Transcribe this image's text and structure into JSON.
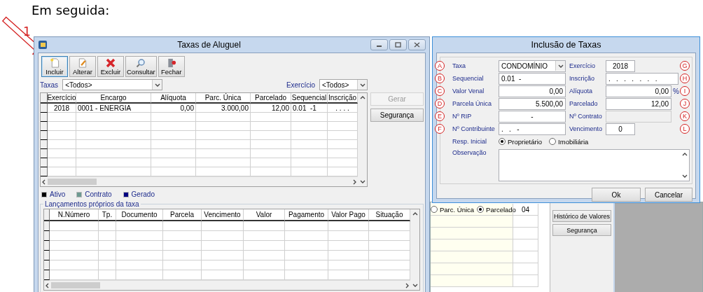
{
  "heading": "Em seguida:",
  "step_marker": "1",
  "main_window": {
    "title": "Taxas de Aluguel",
    "toolbar": [
      {
        "label": "Incluir",
        "focused": true
      },
      {
        "label": "Alterar",
        "focused": false
      },
      {
        "label": "Excluir",
        "focused": false
      },
      {
        "label": "Consultar",
        "focused": false
      },
      {
        "label": "Fechar",
        "focused": false
      }
    ],
    "filters": [
      {
        "label": "Taxas",
        "value": "<Todos>"
      },
      {
        "label": "Exercício",
        "value": "<Todos>"
      }
    ],
    "grid": {
      "columns": [
        "Exercício",
        "Encargo",
        "Alíquota",
        "Parc. Única",
        "Parcelado",
        "Sequencial",
        "Inscrição"
      ],
      "rows": [
        [
          "2018",
          "0001 - ENERGIA",
          "0,00",
          "3.000,00",
          "12,00",
          "0.01  -1",
          ". . . ."
        ]
      ]
    },
    "side_buttons": [
      {
        "label": "Gerar",
        "disabled": true
      },
      {
        "label": "Segurança",
        "disabled": false
      }
    ],
    "legend": [
      {
        "label": "Ativo",
        "color": "#000000"
      },
      {
        "label": "Contrato",
        "color": "#6e9a90"
      },
      {
        "label": "Gerado",
        "color": "#000080"
      }
    ],
    "entries": {
      "title": "Lançamentos próprios da taxa",
      "columns": [
        "N.Número",
        "Tp.",
        "Documento",
        "Parcela",
        "Vencimento",
        "Valor",
        "Pagamento",
        "Valor Pago",
        "Situação"
      ]
    }
  },
  "dialog": {
    "title": "Inclusão de Taxas",
    "rows": [
      {
        "left": {
          "marker": "A",
          "label": "Taxa",
          "value": "CONDOMÍNIO",
          "kind": "combo"
        },
        "right": {
          "marker": "G",
          "label": "Exercício",
          "value": "2018",
          "kind": "short"
        }
      },
      {
        "left": {
          "marker": "B",
          "label": "Sequencial",
          "value": "0.01  -",
          "kind": "text"
        },
        "right": {
          "marker": "H",
          "label": "Inscrição",
          "value": ".   .   .   .   .   .   .",
          "kind": "wide"
        }
      },
      {
        "left": {
          "marker": "C",
          "label": "Valor Venal",
          "value": "0,00",
          "kind": "number"
        },
        "right": {
          "marker": "I",
          "label": "Alíquota",
          "value": "0,00",
          "kind": "number",
          "suffix": "%"
        }
      },
      {
        "left": {
          "marker": "D",
          "label": "Parcela Única",
          "value": "5.500,00",
          "kind": "number"
        },
        "right": {
          "marker": "J",
          "label": "Parcelado",
          "value": "12,00",
          "kind": "number"
        }
      },
      {
        "left": {
          "marker": "E",
          "label": "Nº RIP",
          "value": "-",
          "kind": "center"
        },
        "right": {
          "marker": "K",
          "label": "Nº Contrato",
          "kind": "disabled"
        }
      },
      {
        "left": {
          "marker": "F",
          "label": "Nº Contribuinte",
          "value": ".   .   -",
          "kind": "text"
        },
        "right": {
          "marker": "L",
          "label": "Vencimento",
          "value": "0",
          "kind": "short"
        }
      }
    ],
    "resp": {
      "label": "Resp. Inicial",
      "options": [
        {
          "label": "Proprietário",
          "selected": true
        },
        {
          "label": "Imobiliária",
          "selected": false
        }
      ]
    },
    "observation": {
      "label": "Observação"
    },
    "buttons": [
      "Ok",
      "Cancelar"
    ]
  },
  "background_window": {
    "payment": {
      "options": [
        {
          "label": "Parc. Única",
          "selected": false
        },
        {
          "label": "Parcelado",
          "selected": true
        }
      ],
      "value": "04"
    },
    "buttons": [
      "Histórico de Valores",
      "Segurança"
    ]
  }
}
